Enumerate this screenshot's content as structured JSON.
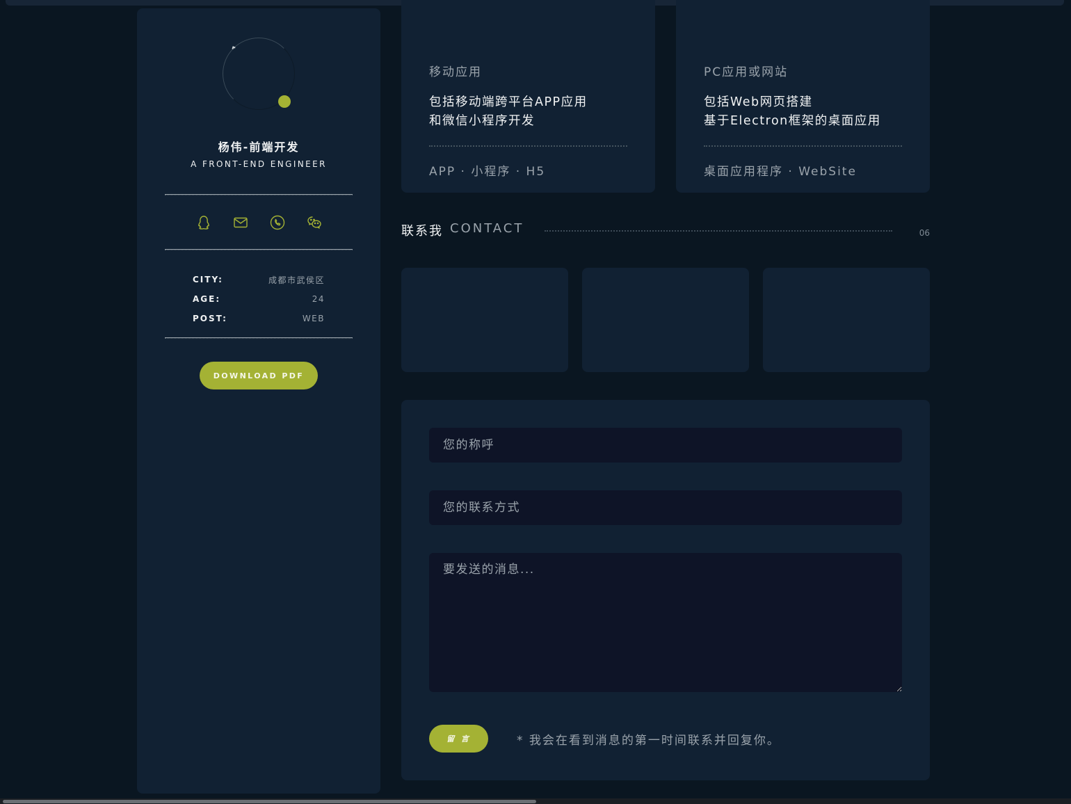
{
  "profile": {
    "name": "杨伟-前端开发",
    "role": "A FRONT-END ENGINEER",
    "social_icons": [
      "qq-icon",
      "mail-icon",
      "phone-icon",
      "wechat-icon"
    ],
    "info": [
      {
        "key": "CITY:",
        "value": "成都市武侯区"
      },
      {
        "key": "AGE:",
        "value": "24"
      },
      {
        "key": "POST:",
        "value": "WEB"
      }
    ],
    "download_label": "DOWNLOAD PDF"
  },
  "services": [
    {
      "title": "移动应用",
      "desc_line1": "包括移动端跨平台APP应用",
      "desc_line2": "和微信小程序开发",
      "tags": "APP · 小程序 · H5"
    },
    {
      "title": "PC应用或网站",
      "desc_line1": "包括Web网页搭建",
      "desc_line2": "基于Electron框架的桌面应用",
      "tags": "桌面应用程序 · WebSite"
    }
  ],
  "contact": {
    "title_cn": "联系我",
    "title_en": "CONTACT",
    "number": "06"
  },
  "form": {
    "name_placeholder": "您的称呼",
    "contact_placeholder": "您的联系方式",
    "message_placeholder": "要发送的消息...",
    "submit_label": "留 言",
    "note": "* 我会在看到消息的第一时间联系并回复你。"
  },
  "colors": {
    "accent": "#a4b234",
    "background": "#0a1621",
    "card": "#112133",
    "input": "#0e1427"
  }
}
